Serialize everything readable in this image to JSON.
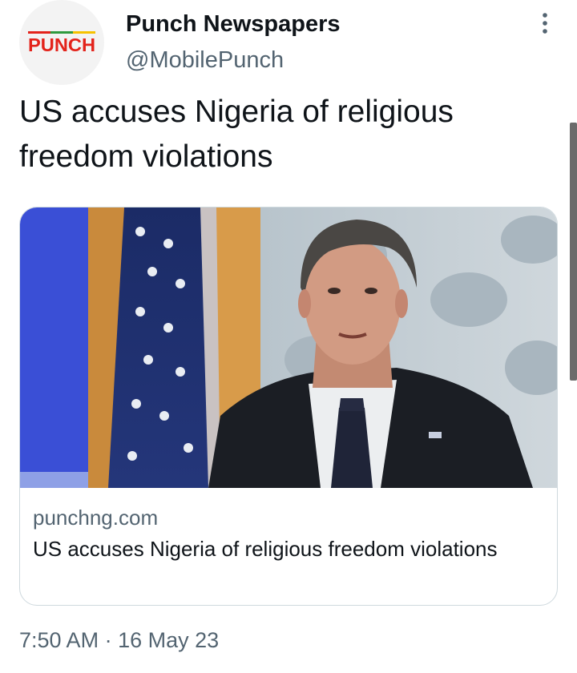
{
  "author": {
    "name": "Punch Newspapers",
    "handle": "@MobilePunch",
    "avatar_logo_text": "PUNCH"
  },
  "tweet": {
    "text": "US accuses Nigeria of religious freedom violations"
  },
  "card": {
    "domain": "punchng.com",
    "title": "US accuses Nigeria of religious freedom violations",
    "image_icon": "news-photo"
  },
  "timestamp": {
    "time": "7:50 AM",
    "separator": "·",
    "date": "16 May 23"
  },
  "more_menu": {
    "icon": "more-vertical-icon"
  },
  "colors": {
    "text_primary": "#0f1419",
    "text_secondary": "#536471",
    "card_border": "#cfd9de",
    "logo_red": "#e3231b",
    "logo_stripe_green": "#2f9a3e",
    "logo_stripe_yellow": "#f6c200"
  }
}
